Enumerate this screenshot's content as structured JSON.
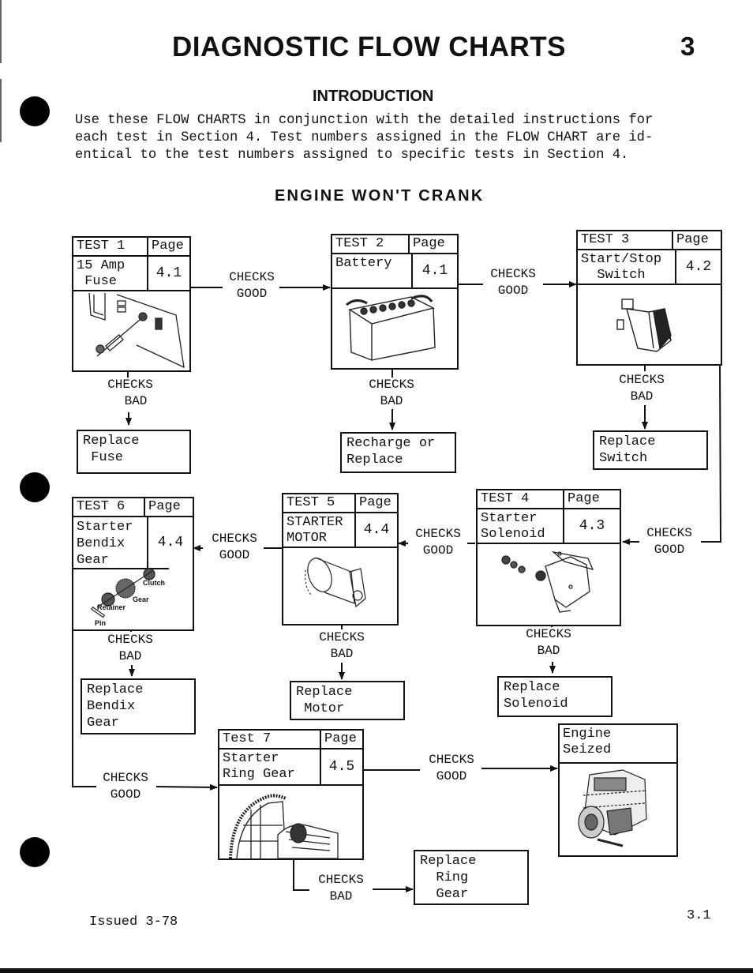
{
  "page": {
    "title": "DIAGNOSTIC FLOW CHARTS",
    "chapter_number": "3",
    "intro_heading": "INTRODUCTION",
    "intro_lines": [
      "Use these FLOW CHARTS in conjunction with the detailed instructions for",
      "each test in Section 4. Test numbers assigned in the FLOW CHART are id-",
      "entical to the test numbers assigned to specific tests in Section 4."
    ],
    "section_heading": "ENGINE WON'T CRANK",
    "footer_issued": "Issued 3-78",
    "footer_page": "3.1"
  },
  "labels": {
    "checks": "CHECKS",
    "good": "GOOD",
    "bad": "BAD",
    "page_header": "Page"
  },
  "tests": [
    {
      "id": "test1",
      "label": "TEST 1",
      "name": "15 Amp\n Fuse",
      "page": "4.1",
      "illustration": "fuse-panel-icon"
    },
    {
      "id": "test2",
      "label": "TEST 2",
      "name": "Battery",
      "page": "4.1",
      "illustration": "battery-icon"
    },
    {
      "id": "test3",
      "label": "TEST 3",
      "name": "Start/Stop\n  Switch",
      "page": "4.2",
      "illustration": "rocker-switch-icon"
    },
    {
      "id": "test4",
      "label": "TEST 4",
      "name": "Starter\nSolenoid",
      "page": "4.3",
      "illustration": "solenoid-icon"
    },
    {
      "id": "test5",
      "label": "TEST 5",
      "name": "STARTER\nMOTOR",
      "page": "4.4",
      "illustration": "starter-motor-icon"
    },
    {
      "id": "test6",
      "label": "TEST 6",
      "name": "Starter\nBendix\nGear",
      "page": "4.4",
      "illustration": "bendix-gear-icon",
      "parts": [
        "Clutch",
        "Gear",
        "Retainer",
        "Pin"
      ]
    },
    {
      "id": "test7",
      "label": "Test 7",
      "name": "Starter\nRing Gear",
      "page": "4.5",
      "illustration": "ring-gear-icon"
    }
  ],
  "actions": {
    "replace_fuse": "Replace\n Fuse",
    "recharge_battery": "Recharge or\nReplace",
    "replace_switch": "Replace\nSwitch",
    "replace_solenoid": "Replace\nSolenoid",
    "replace_motor": "Replace\n Motor",
    "replace_bendix": "Replace\nBendix\nGear",
    "replace_ring_gear": "Replace\n  Ring\n  Gear"
  },
  "terminal": {
    "engine_seized": "Engine\nSeized",
    "illustration": "engine-icon"
  }
}
